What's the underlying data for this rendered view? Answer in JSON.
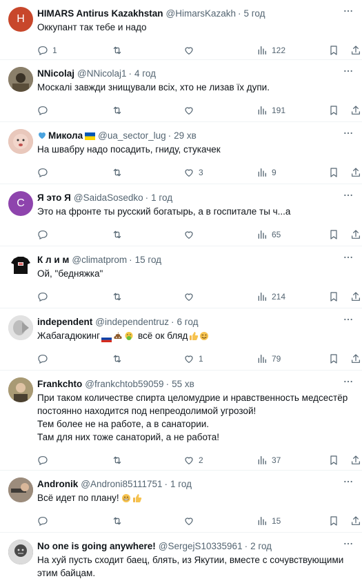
{
  "tweets": [
    {
      "name": "HIMARS Antirus Kazakhstan",
      "handle": "@HimarsKazakh",
      "time": "5 год",
      "text": "Оккупант так тебе и надо",
      "counts": {
        "reply": "1",
        "retweet": "",
        "like": "",
        "views": "122"
      },
      "avatar": {
        "type": "letter",
        "letter": "H",
        "color": "#c8472b"
      }
    },
    {
      "name": "NNicolaj",
      "handle": "@NNicolaj1",
      "time": "4 год",
      "text": "Москалі завжди знищували всіх, хто не лизав їх дупи.",
      "counts": {
        "reply": "",
        "retweet": "",
        "like": "",
        "views": "191"
      },
      "avatar": {
        "type": "photo",
        "color": "#6b5a3a"
      }
    },
    {
      "name": "Микола",
      "handle": "@ua_sector_lug",
      "time": "29 хв",
      "text": "На швабру надо посадить, гниду, стукачек",
      "counts": {
        "reply": "",
        "retweet": "",
        "like": "3",
        "views": "9"
      },
      "avatar": {
        "type": "photo",
        "color": "#d8a89a"
      }
    },
    {
      "name": "Я это Я",
      "handle": "@SaidaSosedko",
      "time": "1 год",
      "text": "Это на фронте ты русский богатырь, а в госпитале ты ч...а",
      "counts": {
        "reply": "",
        "retweet": "",
        "like": "",
        "views": "65"
      },
      "avatar": {
        "type": "letter",
        "letter": "C",
        "color": "#8e44ad"
      }
    },
    {
      "name": "К л и м",
      "handle": "@climatprom",
      "time": "15 год",
      "text": "Ой, \"бедняжка\"",
      "counts": {
        "reply": "",
        "retweet": "",
        "like": "",
        "views": "214"
      },
      "avatar": {
        "type": "photo",
        "color": "#1a1a1a"
      }
    },
    {
      "name": "independent",
      "handle": "@independentruz",
      "time": "6 год",
      "text": "Жабагадюкинг",
      "text_tail": "всё ок бляд",
      "counts": {
        "reply": "",
        "retweet": "",
        "like": "1",
        "views": "79"
      },
      "avatar": {
        "type": "photo",
        "color": "#cfcfcf"
      }
    },
    {
      "name": "Frankchto",
      "handle": "@frankchtob59059",
      "time": "55 хв",
      "text": "При таком количестве спирта целомудрие и нравственность медсестёр\nпостоянно находится под непреодолимой угрозой!\nТем более не на работе, а в санатории.\nТам для них тоже санаторий, а не работа!",
      "counts": {
        "reply": "",
        "retweet": "",
        "like": "2",
        "views": "37"
      },
      "avatar": {
        "type": "photo",
        "color": "#8a7a5a"
      }
    },
    {
      "name": "Andronik",
      "handle": "@Androni85111751",
      "time": "1 год",
      "text": "Всё идет по плану!",
      "counts": {
        "reply": "",
        "retweet": "",
        "like": "",
        "views": "15"
      },
      "avatar": {
        "type": "photo",
        "color": "#7a6a5a"
      }
    },
    {
      "name": "No one is going anywhere!",
      "handle": "@SergejS10335961",
      "time": "2 год",
      "text": "На хуй пусть сходит баец, блять, из Якутии, вместе с сочувствующими\nэтим байцам.",
      "counts": {
        "reply": "",
        "retweet": "",
        "like": "",
        "views": ""
      },
      "avatar": {
        "type": "photo",
        "color": "#555555"
      }
    }
  ],
  "icons": {
    "reply": "reply-icon",
    "retweet": "retweet-icon",
    "like": "like-icon",
    "views": "views-icon",
    "bookmark": "bookmark-icon",
    "share": "share-icon",
    "more": "more-icon"
  },
  "colors": {
    "text": "#0f1419",
    "muted": "#536471",
    "border": "#eff3f4"
  }
}
